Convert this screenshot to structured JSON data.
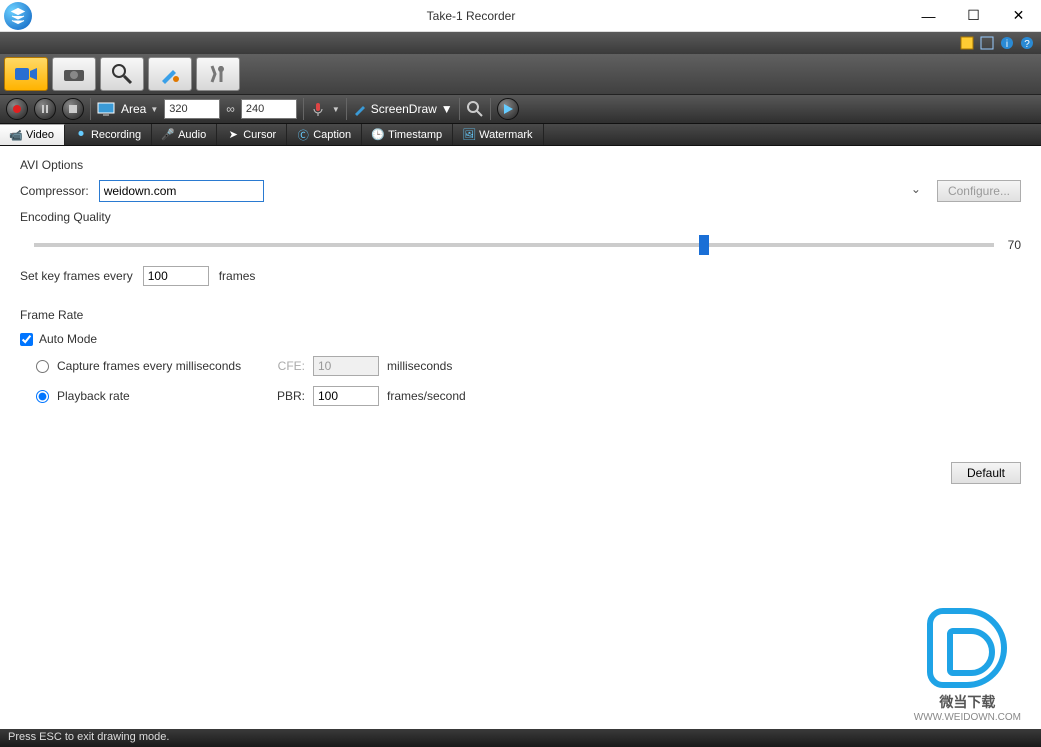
{
  "window": {
    "title": "Take-1 Recorder",
    "minimize": "—",
    "maximize": "☐",
    "close": "✕"
  },
  "topright_icons": [
    "grid-icon",
    "fullscreen-icon",
    "info-icon",
    "help-icon"
  ],
  "toolbar_big": [
    "camcorder-icon",
    "camera-icon",
    "magnify-icon",
    "brush-icon",
    "tools-icon"
  ],
  "ctrl": {
    "area_label": "Area",
    "width": "320",
    "height": "240",
    "link_icon": "∞",
    "screendraw": "ScreenDraw"
  },
  "tabs": [
    {
      "icon": "video-icon",
      "label": "Video"
    },
    {
      "icon": "recording-icon",
      "label": "Recording"
    },
    {
      "icon": "audio-icon",
      "label": "Audio"
    },
    {
      "icon": "cursor-icon",
      "label": "Cursor"
    },
    {
      "icon": "caption-icon",
      "label": "Caption"
    },
    {
      "icon": "timestamp-icon",
      "label": "Timestamp"
    },
    {
      "icon": "watermark-icon",
      "label": "Watermark"
    }
  ],
  "pane": {
    "avi_options": "AVI Options",
    "compressor_label": "Compressor:",
    "compressor_value": "weidown.com",
    "configure": "Configure...",
    "encoding_quality": "Encoding Quality",
    "quality_value": "70",
    "set_keyframes": "Set key frames every",
    "keyframes_value": "100",
    "frames": "frames",
    "frame_rate": "Frame Rate",
    "auto_mode": "Auto Mode",
    "capture_every": "Capture frames every milliseconds",
    "cfe": "CFE:",
    "cfe_value": "10",
    "ms": "milliseconds",
    "playback_rate": "Playback rate",
    "pbr": "PBR:",
    "pbr_value": "100",
    "fps": "frames/second",
    "default": "Default"
  },
  "status": "Press ESC to exit drawing mode.",
  "watermark": {
    "line1": "微当下载",
    "line2": "WWW.WEIDOWN.COM"
  }
}
